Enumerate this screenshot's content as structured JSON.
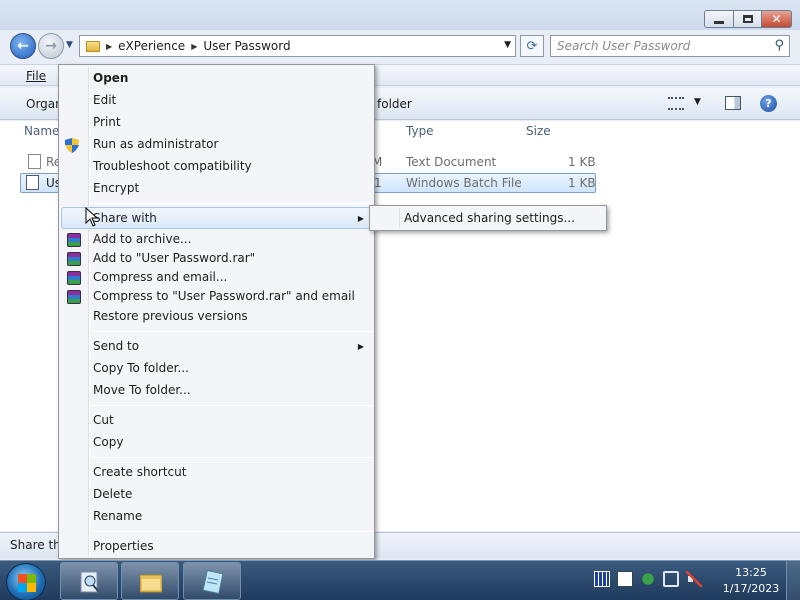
{
  "window": {
    "address": {
      "segments": [
        "eXPerience",
        "User Password"
      ]
    },
    "search_placeholder": "Search User Password",
    "menu": {
      "file": "File"
    },
    "command_bar": {
      "organize": "Organ",
      "new_folder": "folder"
    },
    "columns": {
      "name": "Name",
      "type": "Type",
      "size": "Size"
    },
    "files": [
      {
        "name": "Re",
        "date_fragment": "M",
        "type": "Text Document",
        "size": "1 KB"
      },
      {
        "name": "Us",
        "date_fragment": "1",
        "type": "Windows Batch File",
        "size": "1 KB",
        "selected": true
      }
    ],
    "status": "Share the"
  },
  "context_menu": {
    "items": [
      {
        "label": "Open",
        "bold": true
      },
      {
        "label": "Edit"
      },
      {
        "label": "Print"
      },
      {
        "label": "Run as administrator",
        "icon": "uac-shield-icon"
      },
      {
        "label": "Troubleshoot compatibility"
      },
      {
        "label": "Encrypt"
      },
      {
        "label": "Share with",
        "submenu": true,
        "highlighted": true
      },
      {
        "label": "Add to archive...",
        "icon": "winrar-icon"
      },
      {
        "label": "Add to \"User Password.rar\"",
        "icon": "winrar-icon"
      },
      {
        "label": "Compress and email...",
        "icon": "winrar-icon"
      },
      {
        "label": "Compress to \"User Password.rar\" and email",
        "icon": "winrar-icon"
      },
      {
        "label": "Restore previous versions"
      },
      {
        "label": "Send to",
        "submenu": true
      },
      {
        "label": "Copy To folder..."
      },
      {
        "label": "Move To folder..."
      },
      {
        "label": "Cut"
      },
      {
        "label": "Copy"
      },
      {
        "label": "Create shortcut"
      },
      {
        "label": "Delete"
      },
      {
        "label": "Rename"
      },
      {
        "label": "Properties"
      }
    ],
    "submenu": {
      "label": "Advanced sharing settings..."
    }
  },
  "taskbar": {
    "apps": [
      "search-icon",
      "folder-icon",
      "notepad-icon"
    ],
    "clock": {
      "time": "13:25",
      "date": "1/17/2023"
    }
  },
  "colors": {
    "selection": "#cfe5fb",
    "taskbar": "#1f3a5c",
    "accent": "#1d5fbf"
  }
}
